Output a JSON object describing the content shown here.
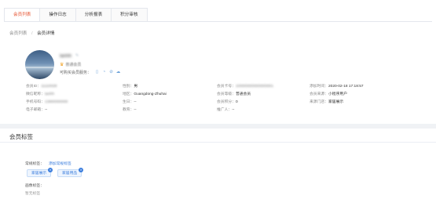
{
  "tabs": [
    {
      "label": "会员列表",
      "active": true
    },
    {
      "label": "操作日志",
      "active": false
    },
    {
      "label": "分析报表",
      "active": false
    },
    {
      "label": "积分审核",
      "active": false
    }
  ],
  "breadcrumb": {
    "root": "会员列表",
    "separator": "/",
    "current": "会员详情"
  },
  "profile": {
    "nickname": "tanhh",
    "level": "普通会员",
    "bind_label": "可购买会员服务：",
    "bind_icons": [
      "phone-icon",
      "wechat-icon",
      "alipay-icon",
      "cloud-icon"
    ]
  },
  "info_rows": [
    [
      {
        "key": "会员ID：",
        "value": "11110028",
        "blur": true
      },
      {
        "key": "性别：",
        "value": "男",
        "blur": false
      },
      {
        "key": "会员卡号：",
        "value": "100000000000000001",
        "blur": true
      },
      {
        "key": "添加时间：",
        "value": "2020-02-18 17:18:57",
        "blur": false
      }
    ],
    [
      {
        "key": "微信昵称：",
        "value": "tanhh",
        "blur": true
      },
      {
        "key": "地区：",
        "value": "Guangdong-Zhuhai",
        "blur": false
      },
      {
        "key": "会员等级：",
        "value": "普通会员",
        "blur": false
      },
      {
        "key": "会员来源：",
        "value": "小程序用户",
        "blur": false
      }
    ],
    [
      {
        "key": "手机号码：",
        "value": "13800000000",
        "blur": true
      },
      {
        "key": "生日：",
        "value": "--",
        "blur": false
      },
      {
        "key": "会员积分：",
        "value": "0",
        "blur": false
      },
      {
        "key": "来源门店：",
        "value": "家居展示",
        "blur": false
      }
    ],
    [
      {
        "key": "电子邮箱：",
        "value": "--",
        "blur": false
      },
      {
        "key": "教育：",
        "value": "--",
        "blur": false
      },
      {
        "key": "推广人：",
        "value": "--",
        "blur": false
      }
    ]
  ],
  "section": {
    "title": "会员标签"
  },
  "tags": {
    "label": "常规标签：",
    "add_link": "添加常规标签",
    "items": [
      "家居展示",
      "家居用品"
    ]
  },
  "portrait": {
    "label": "画像标签：",
    "empty": "暂无标签"
  },
  "colors": {
    "accent": "#e6502d",
    "link": "#3b7ddd",
    "crown": "#f0a020"
  }
}
